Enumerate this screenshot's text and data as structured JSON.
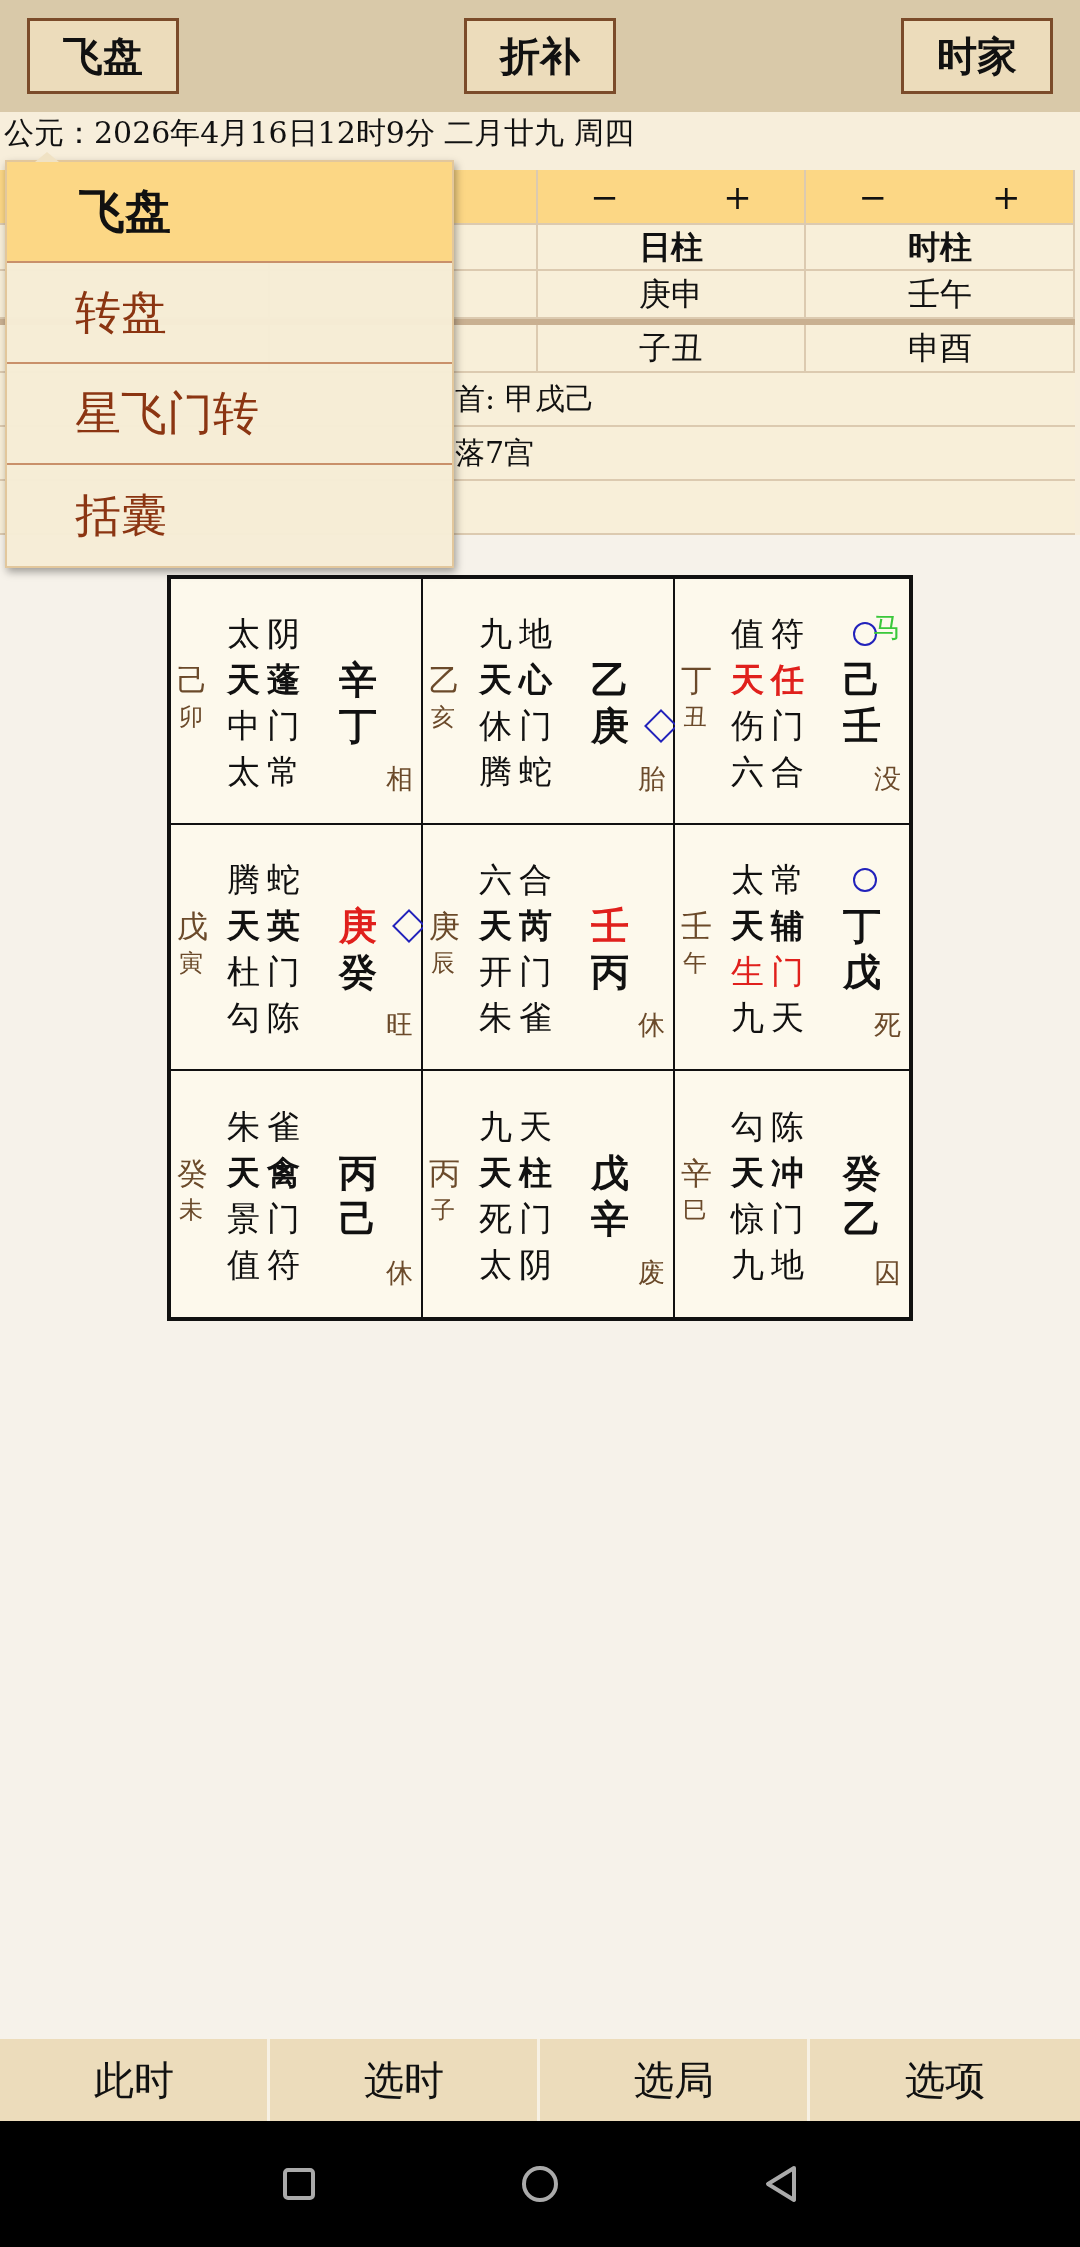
{
  "toolbar": {
    "buttons": [
      "飞盘",
      "折补",
      "时家"
    ]
  },
  "date_line": "公元：2026年4月16日12时9分  二月廿九 周四",
  "pillars": [
    {
      "minus": "−",
      "plus": "+",
      "title": "日柱",
      "stem_branch": "庚申",
      "void": "子丑"
    },
    {
      "minus": "−",
      "plus": "+",
      "title": "时柱",
      "stem_branch": "壬午",
      "void": "申酉"
    }
  ],
  "info_lines": [
    "首: 甲戌己",
    "落7宫"
  ],
  "menu": {
    "items": [
      {
        "label": "飞盘",
        "selected": true
      },
      {
        "label": "转盘",
        "selected": false
      },
      {
        "label": "星飞门转",
        "selected": false
      },
      {
        "label": "括囊",
        "selected": false
      }
    ]
  },
  "grid": {
    "cells": [
      {
        "god": "太阴",
        "star": "天蓬",
        "door": "中门",
        "deity": "太常",
        "left_stem": "己",
        "left_branch": "卯",
        "top_stem": "辛",
        "bottom_stem": "丁",
        "state": "相",
        "star_red": false,
        "door_red": false,
        "top_stem_red": false,
        "top_diamond": false,
        "bottom_diamond": false,
        "circle": false
      },
      {
        "god": "九地",
        "star": "天心",
        "door": "休门",
        "deity": "腾蛇",
        "left_stem": "乙",
        "left_branch": "亥",
        "top_stem": "乙",
        "bottom_stem": "庚",
        "state": "胎",
        "star_red": false,
        "door_red": false,
        "top_stem_red": false,
        "top_diamond": false,
        "bottom_diamond": true,
        "circle": false
      },
      {
        "god": "值符",
        "star": "天任",
        "door": "伤门",
        "deity": "六合",
        "left_stem": "丁",
        "left_branch": "丑",
        "top_stem": "己",
        "bottom_stem": "壬",
        "state": "没",
        "star_red": true,
        "door_red": false,
        "top_stem_red": false,
        "top_diamond": false,
        "bottom_diamond": false,
        "circle": true,
        "horse": "马"
      },
      {
        "god": "腾蛇",
        "star": "天英",
        "door": "杜门",
        "deity": "勾陈",
        "left_stem": "戊",
        "left_branch": "寅",
        "top_stem": "庚",
        "bottom_stem": "癸",
        "state": "旺",
        "star_red": false,
        "door_red": false,
        "top_stem_red": true,
        "top_diamond": true,
        "bottom_diamond": false,
        "circle": false
      },
      {
        "god": "六合",
        "star": "天芮",
        "door": "开门",
        "deity": "朱雀",
        "left_stem": "庚",
        "left_branch": "辰",
        "top_stem": "壬",
        "bottom_stem": "丙",
        "state": "休",
        "star_red": false,
        "door_red": false,
        "top_stem_red": true,
        "top_diamond": false,
        "bottom_diamond": false,
        "circle": false
      },
      {
        "god": "太常",
        "star": "天辅",
        "door": "生门",
        "deity": "九天",
        "left_stem": "壬",
        "left_branch": "午",
        "top_stem": "丁",
        "bottom_stem": "戊",
        "state": "死",
        "star_red": false,
        "door_red": true,
        "top_stem_red": false,
        "top_diamond": false,
        "bottom_diamond": false,
        "circle": true
      },
      {
        "god": "朱雀",
        "star": "天禽",
        "door": "景门",
        "deity": "值符",
        "left_stem": "癸",
        "left_branch": "未",
        "top_stem": "丙",
        "bottom_stem": "己",
        "state": "休",
        "star_red": false,
        "door_red": false,
        "top_stem_red": false,
        "top_diamond": false,
        "bottom_diamond": false,
        "circle": false
      },
      {
        "god": "九天",
        "star": "天柱",
        "door": "死门",
        "deity": "太阴",
        "left_stem": "丙",
        "left_branch": "子",
        "top_stem": "戊",
        "bottom_stem": "辛",
        "state": "废",
        "star_red": false,
        "door_red": false,
        "top_stem_red": false,
        "top_diamond": false,
        "bottom_diamond": false,
        "circle": false
      },
      {
        "god": "勾陈",
        "star": "天冲",
        "door": "惊门",
        "deity": "九地",
        "left_stem": "辛",
        "left_branch": "巳",
        "top_stem": "癸",
        "bottom_stem": "乙",
        "state": "囚",
        "star_red": false,
        "door_red": false,
        "top_stem_red": false,
        "top_diamond": false,
        "bottom_diamond": false,
        "circle": false
      }
    ]
  },
  "bottom_bar": [
    "此时",
    "选时",
    "选局",
    "选项"
  ]
}
